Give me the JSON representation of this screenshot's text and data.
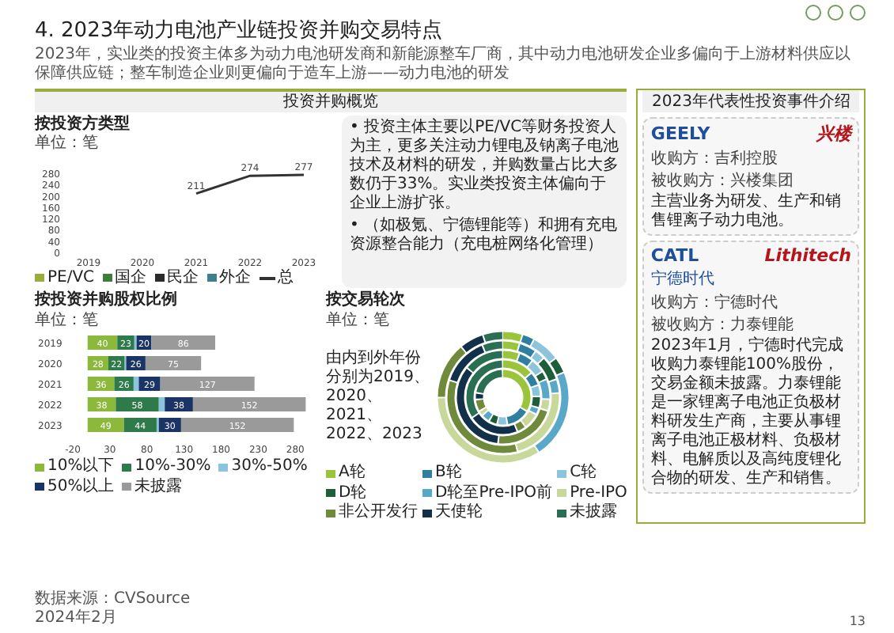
{
  "title": "4. 2023年动力电池产业链投资并购交易特点",
  "subtitle": "2023年，实业类的投资主体多为动力电池研发商和新能源整车厂商，其中动力电池研发企业多偏向于上游材料供应以保障供应链；整车制造企业则更偏向于造车上游——动力电池的研发",
  "overview": {
    "header": "投资并购概览",
    "by_investor": {
      "title": "按投资方类型",
      "unit": "单位：笔",
      "chart_data": {
        "type": "line",
        "categories": [
          "2019",
          "2020",
          "2021",
          "2022",
          "2023"
        ],
        "yticks": [
          0,
          40,
          80,
          120,
          160,
          200,
          240,
          280
        ],
        "ylim": [
          0,
          280
        ],
        "series": [
          {
            "name": "总",
            "color": "#333333",
            "values": [
              null,
              null,
              211,
              274,
              277
            ]
          }
        ],
        "data_labels": true
      },
      "legend": [
        {
          "label": "PE/VC",
          "color": "#9aad3c"
        },
        {
          "label": "国企",
          "color": "#3e7d3a"
        },
        {
          "label": "民企",
          "color": "#2b2b2b"
        },
        {
          "label": "外企",
          "color": "#3f7f8c"
        }
      ]
    },
    "bullets": [
      "• 投资主体主要以PE/VC等财务投资人为主，更多关注动力锂电及钠离子电池技术及材料的研发，并购数量占比大多数仍于33%。实业类投资主体偏向于企业上游扩张。",
      "• （如极氪、宁德锂能等）和拥有充电资源整合能力（充电桩网络化管理）"
    ],
    "by_equity": {
      "title": "按投资并购股权比例",
      "unit": "单位：笔",
      "chart_data": {
        "type": "bar",
        "orientation": "horizontal",
        "stacked": true,
        "categories": [
          "2019",
          "2020",
          "2021",
          "2022",
          "2023"
        ],
        "xlim": [
          -20,
          300
        ],
        "xticks": [
          -20,
          30,
          80,
          130,
          180,
          230,
          280
        ],
        "series": [
          {
            "name": "10%以下",
            "color": "#8cb83c",
            "values": [
              40,
              28,
              36,
              38,
              49
            ]
          },
          {
            "name": "10%-30%",
            "color": "#2f7a4a",
            "values": [
              23,
              22,
              26,
              58,
              44
            ]
          },
          {
            "name": "30%-50%",
            "color": "#8cc4dc",
            "values": [
              3,
              2,
              7,
              8,
              3
            ]
          },
          {
            "name": "50%以上",
            "color": "#1a3466",
            "values": [
              20,
              26,
              29,
              38,
              30
            ]
          },
          {
            "name": "未披露",
            "color": "#9a9a9a",
            "values": [
              86,
              75,
              127,
              152,
              152
            ]
          }
        ],
        "value_labels": [
          [
            "40",
            "28",
            "36",
            "38",
            "49"
          ],
          [
            "23",
            "22",
            "26",
            "58",
            "44"
          ],
          [
            null,
            null,
            null,
            null,
            null
          ],
          [
            "20",
            "26",
            "29",
            "38",
            "30"
          ],
          [
            "86",
            "75",
            "127",
            "152",
            "152"
          ]
        ]
      }
    },
    "by_round": {
      "title": "按交易轮次",
      "unit": "单位：笔",
      "note": "由内到外年份分别为2019、2020、2021、2022、2023",
      "legend": [
        {
          "label": "A轮",
          "color": "#9ac43c"
        },
        {
          "label": "B轮",
          "color": "#2e7fa0"
        },
        {
          "label": "C轮",
          "color": "#8cc4dc"
        },
        {
          "label": "D轮",
          "color": "#1e5e3a"
        },
        {
          "label": "D轮至Pre-IPO前",
          "color": "#5aa8c8"
        },
        {
          "label": "Pre-IPO",
          "color": "#c8d89a"
        },
        {
          "label": "非公开发行",
          "color": "#6e8a3a"
        },
        {
          "label": "天使轮",
          "color": "#12304a"
        },
        {
          "label": "未披露",
          "color": "#2a6f54"
        }
      ]
    }
  },
  "events": {
    "header": "2023年代表性投资事件介绍",
    "cards": [
      {
        "logos": [
          "GEELY",
          "兴楼"
        ],
        "acquirer": "收购方：吉利控股",
        "target": "被收购方：兴楼集团",
        "text": "主营业务为研发、生产和销售锂离子动力电池。"
      },
      {
        "logos": [
          "CATL",
          "Lithitech"
        ],
        "logo_sub": "宁德时代",
        "acquirer": "收购方：宁德时代",
        "target": "被收购方：力泰锂能",
        "text": "2023年1月，宁德时代完成收购力泰锂能100%股份，交易金额未披露。力泰锂能是一家锂离子电池正负极材料研发生产商，主要从事锂离子电池正极材料、负极材料、电解质以及高纯度锂化合物的研发、生产和销售。"
      }
    ]
  },
  "source": "数据来源：CVSource",
  "date": "2024年2月",
  "page": "13"
}
